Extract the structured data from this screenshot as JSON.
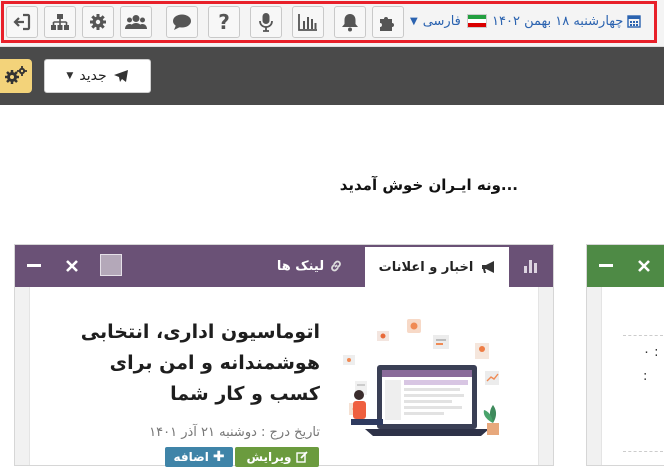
{
  "toolbar": {
    "date": "چهارشنبه ۱۸ بهمن ۱۴۰۲",
    "language": "فارسی",
    "icons": [
      "logout-icon",
      "org-chart-icon",
      "gear-icon",
      "users-icon",
      "chat-icon",
      "help-icon",
      "microphone-icon",
      "bar-chart-icon",
      "bell-icon",
      "puzzle-icon",
      "calendar-icon",
      "flag-iran-icon"
    ],
    "help_glyph": "?"
  },
  "actionbar": {
    "new_label": "جدید"
  },
  "welcome": {
    "text": "...ونه ایـران خوش آمدید"
  },
  "news_panel": {
    "tabs": [
      {
        "label": "اخبار و اعلانات",
        "active": true
      },
      {
        "label": "لینک ها",
        "active": false
      }
    ],
    "headline": "اتوماسیون اداری، انتخابی هوشمندانه و امن برای کسب و کار شما",
    "date_text": "تاریخ درج : دوشنبه ۲۱ آذر ۱۴۰۱",
    "edit_label": "ویرایش",
    "add_label": "اضافه"
  },
  "side_panel": {
    "value_1": ": ۰",
    "value_2": ":"
  },
  "colors": {
    "toolbar_bg": "#f4f4f4",
    "highlight": "#e8202a",
    "dark_bar": "#4a4a4a",
    "gear_btn": "#f3d37a",
    "news_header": "#6a5176",
    "side_header": "#4e8a45",
    "edit_btn": "#6b9b3e",
    "add_btn": "#3f84a8",
    "link_blue": "#2b63b0"
  }
}
